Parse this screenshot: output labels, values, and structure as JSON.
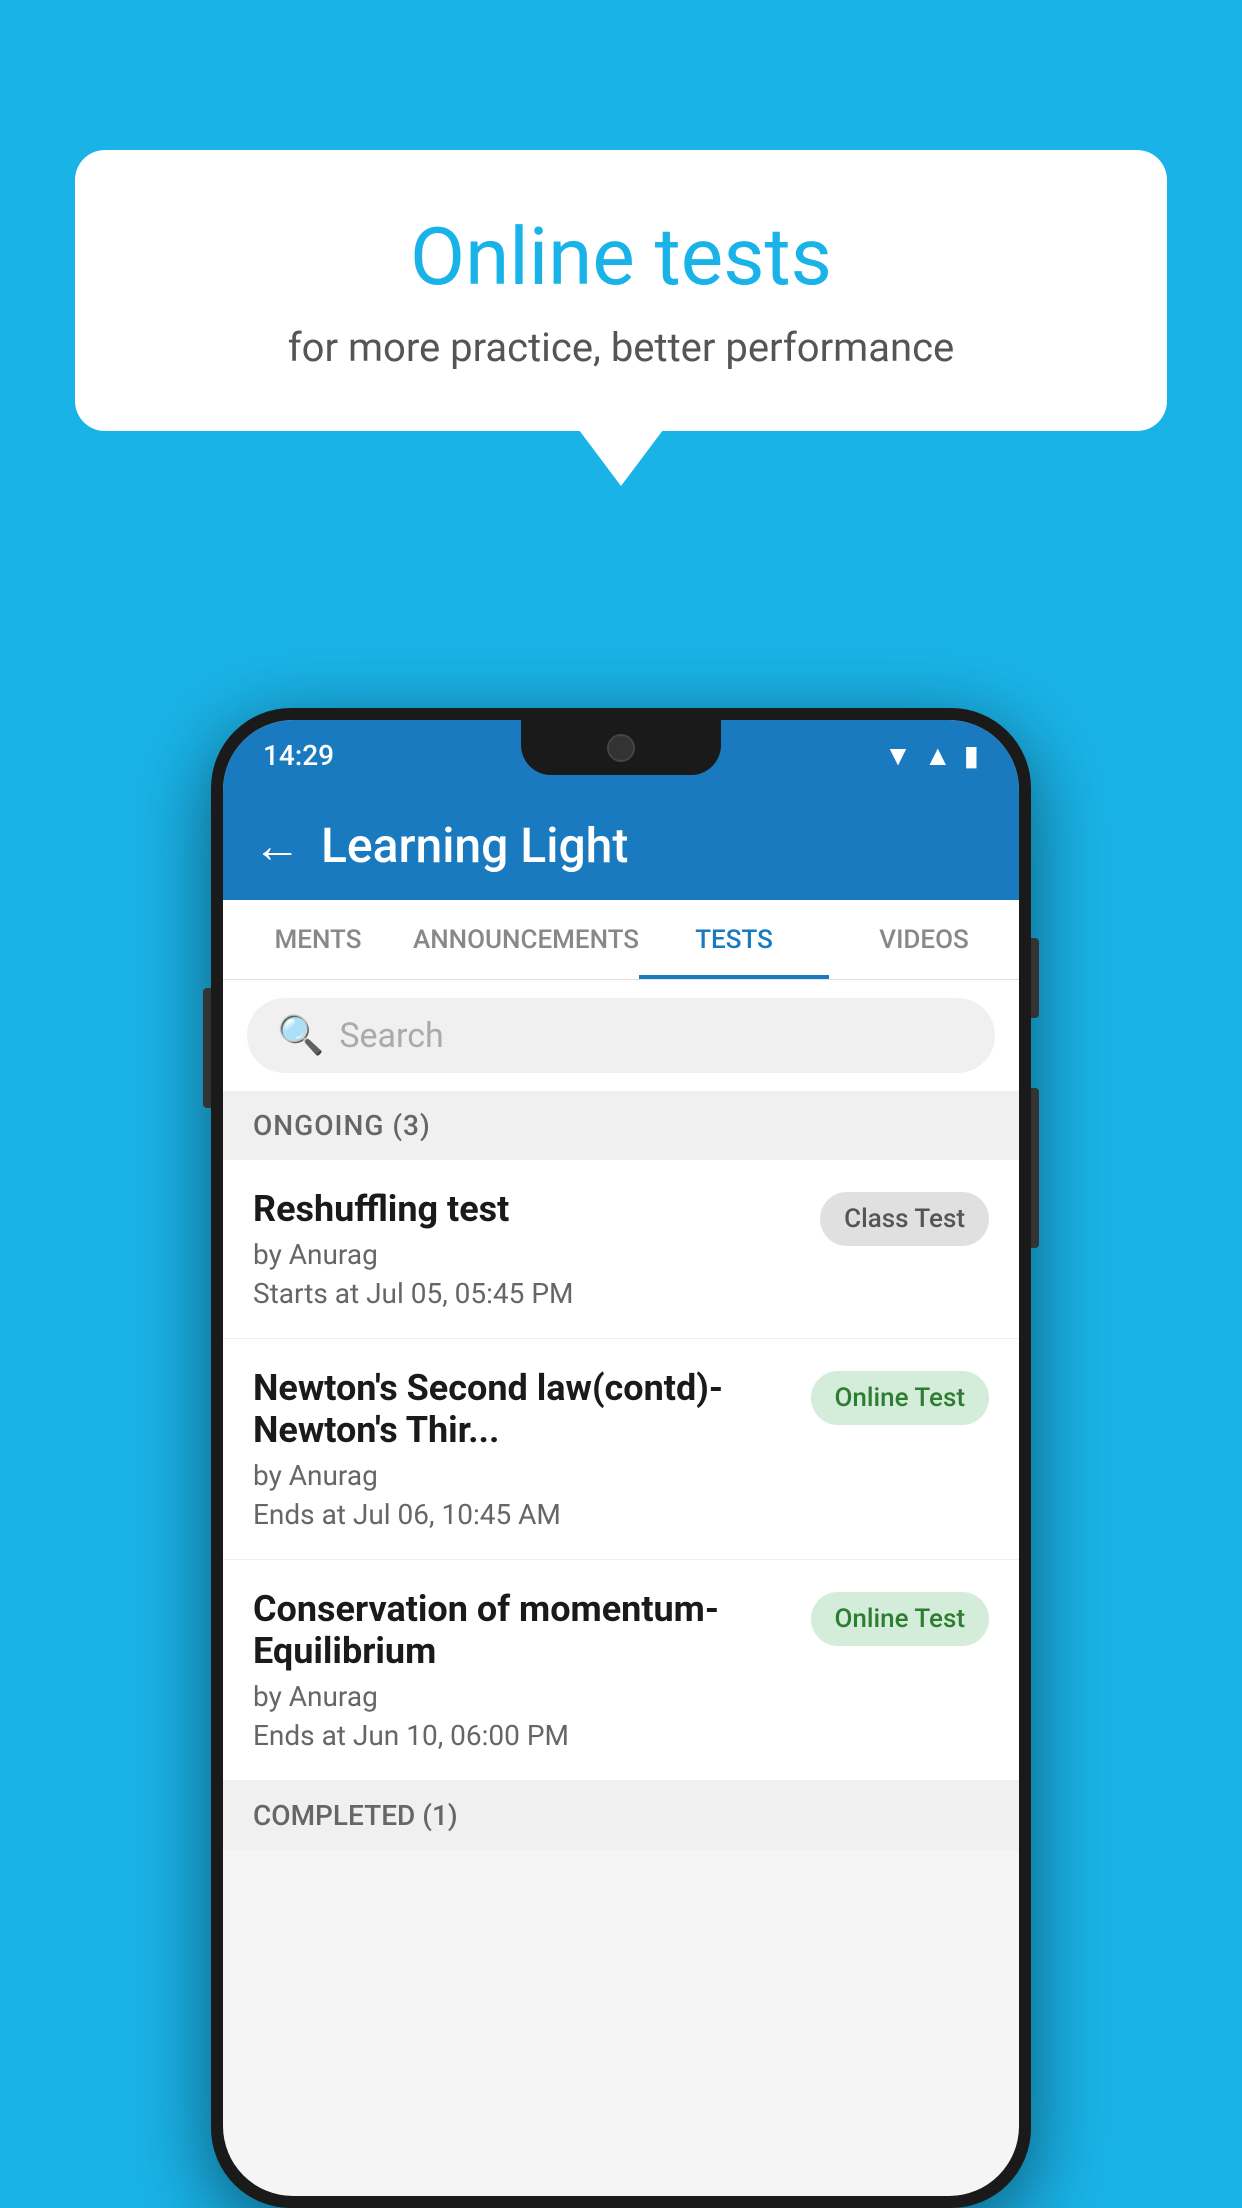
{
  "background": {
    "color": "#1ab3e8"
  },
  "bubble": {
    "title": "Online tests",
    "subtitle": "for more practice, better performance"
  },
  "status_bar": {
    "time": "14:29",
    "icons": [
      "wifi",
      "signal",
      "battery"
    ]
  },
  "app_bar": {
    "back_label": "←",
    "title": "Learning Light"
  },
  "tabs": [
    {
      "label": "MENTS",
      "active": false
    },
    {
      "label": "ANNOUNCEMENTS",
      "active": false
    },
    {
      "label": "TESTS",
      "active": true
    },
    {
      "label": "VIDEOS",
      "active": false
    }
  ],
  "search": {
    "placeholder": "Search",
    "icon": "🔍"
  },
  "ongoing_section": {
    "label": "ONGOING (3)"
  },
  "tests": [
    {
      "name": "Reshuffling test",
      "author": "by Anurag",
      "time_label": "Starts at",
      "time_value": "Jul 05, 05:45 PM",
      "badge": "Class Test",
      "badge_type": "class"
    },
    {
      "name": "Newton's Second law(contd)-Newton's Thir...",
      "author": "by Anurag",
      "time_label": "Ends at",
      "time_value": "Jul 06, 10:45 AM",
      "badge": "Online Test",
      "badge_type": "online"
    },
    {
      "name": "Conservation of momentum-Equilibrium",
      "author": "by Anurag",
      "time_label": "Ends at",
      "time_value": "Jun 10, 06:00 PM",
      "badge": "Online Test",
      "badge_type": "online"
    }
  ],
  "completed_section": {
    "label": "COMPLETED (1)"
  }
}
